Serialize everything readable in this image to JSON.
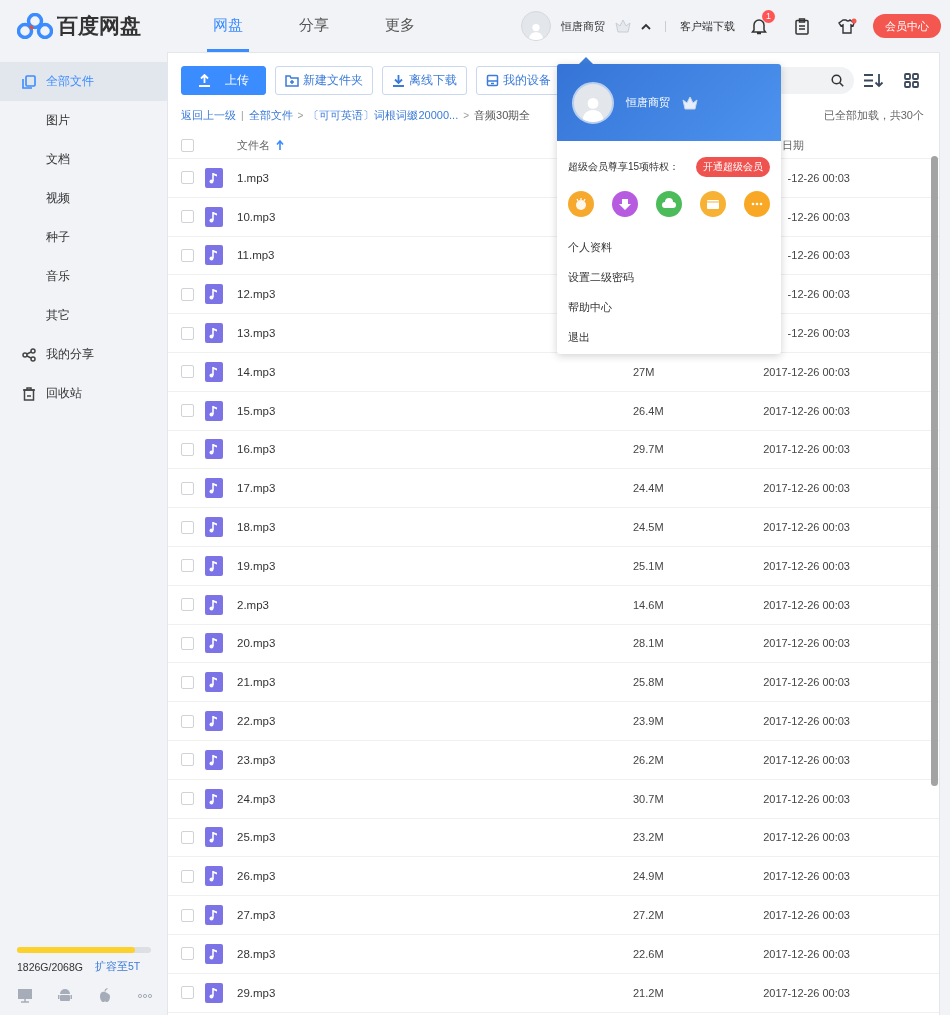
{
  "header": {
    "logo": "百度网盘",
    "nav": [
      {
        "label": "网盘",
        "selected": true
      },
      {
        "label": "分享",
        "selected": false
      },
      {
        "label": "更多",
        "selected": false
      }
    ],
    "username": "恒唐商贸",
    "client_link": "客户端下载",
    "notification_count": "1",
    "vip_button": "会员中心"
  },
  "sidebar": {
    "items": [
      {
        "label": "全部文件",
        "selected": true,
        "children": [
          {
            "label": "图片",
            "selected": false
          },
          {
            "label": "文档",
            "selected": false
          },
          {
            "label": "视频",
            "selected": false
          },
          {
            "label": "种子",
            "selected": false
          },
          {
            "label": "音乐",
            "selected": false
          },
          {
            "label": "其它",
            "selected": false
          }
        ]
      },
      {
        "label": "我的分享",
        "selected": false
      },
      {
        "label": "回收站",
        "selected": false
      }
    ],
    "storage": {
      "level": 0.883,
      "usage": "1826G/2068G",
      "upgrade_link": "扩容至5T"
    }
  },
  "toolbar": {
    "buttons": [
      {
        "label": "上传",
        "kind": "primary"
      },
      {
        "label": "新建文件夹",
        "kind": "default"
      },
      {
        "label": "离线下载",
        "kind": "default"
      },
      {
        "label": "我的设备",
        "kind": "default"
      }
    ]
  },
  "breadcrumb": {
    "back": "返回上一级",
    "divider": "|",
    "items": [
      {
        "label": "全部文件",
        "separator": ">"
      },
      {
        "label": "〔可可英语〕词根词缀20000...",
        "separator": ">"
      },
      {
        "label": "音频30期全"
      }
    ]
  },
  "load_status": "已全部加载，共30个",
  "table": {
    "all_checked": false,
    "columns": [
      {
        "label": "文件名",
        "sorted": true
      },
      {
        "label": "日期",
        "sorted": false
      }
    ],
    "rows": [
      {
        "name": "1.mp3",
        "date": "-12-26 00:03",
        "checked": false
      },
      {
        "name": "10.mp3",
        "date": "-12-26 00:03",
        "checked": false
      },
      {
        "name": "11.mp3",
        "date": "-12-26 00:03",
        "checked": false
      },
      {
        "name": "12.mp3",
        "date": "-12-26 00:03",
        "checked": false
      },
      {
        "name": "13.mp3",
        "date": "-12-26 00:03",
        "checked": false
      },
      {
        "name": "14.mp3",
        "size": "27M",
        "date": "2017-12-26 00:03",
        "checked": false
      },
      {
        "name": "15.mp3",
        "size": "26.4M",
        "date": "2017-12-26 00:03",
        "checked": false
      },
      {
        "name": "16.mp3",
        "size": "29.7M",
        "date": "2017-12-26 00:03",
        "checked": false
      },
      {
        "name": "17.mp3",
        "size": "24.4M",
        "date": "2017-12-26 00:03",
        "checked": false
      },
      {
        "name": "18.mp3",
        "size": "24.5M",
        "date": "2017-12-26 00:03",
        "checked": false
      },
      {
        "name": "19.mp3",
        "size": "25.1M",
        "date": "2017-12-26 00:03",
        "checked": false
      },
      {
        "name": "2.mp3",
        "size": "14.6M",
        "date": "2017-12-26 00:03",
        "checked": false
      },
      {
        "name": "20.mp3",
        "size": "28.1M",
        "date": "2017-12-26 00:03",
        "checked": false
      },
      {
        "name": "21.mp3",
        "size": "25.8M",
        "date": "2017-12-26 00:03",
        "checked": false
      },
      {
        "name": "22.mp3",
        "size": "23.9M",
        "date": "2017-12-26 00:03",
        "checked": false
      },
      {
        "name": "23.mp3",
        "size": "26.2M",
        "date": "2017-12-26 00:03",
        "checked": false
      },
      {
        "name": "24.mp3",
        "size": "30.7M",
        "date": "2017-12-26 00:03",
        "checked": false
      },
      {
        "name": "25.mp3",
        "size": "23.2M",
        "date": "2017-12-26 00:03",
        "checked": false
      },
      {
        "name": "26.mp3",
        "size": "24.9M",
        "date": "2017-12-26 00:03",
        "checked": false
      },
      {
        "name": "27.mp3",
        "size": "27.2M",
        "date": "2017-12-26 00:03",
        "checked": false
      },
      {
        "name": "28.mp3",
        "size": "22.6M",
        "date": "2017-12-26 00:03",
        "checked": false
      },
      {
        "name": "29.mp3",
        "size": "21.2M",
        "date": "2017-12-26 00:03",
        "checked": false
      }
    ]
  },
  "user_menu": {
    "name": "恒唐商贸",
    "promo": "超级会员尊享15项特权：",
    "promo_button": "开通超级会员",
    "privileges": [
      {
        "color": "#f7a92e"
      },
      {
        "color": "#b75ce0"
      },
      {
        "color": "#4cbb5a"
      },
      {
        "color": "#f7b134"
      },
      {
        "color": "#f9a825"
      }
    ],
    "items": [
      "个人资料",
      "设置二级密码",
      "帮助中心",
      "退出"
    ]
  }
}
